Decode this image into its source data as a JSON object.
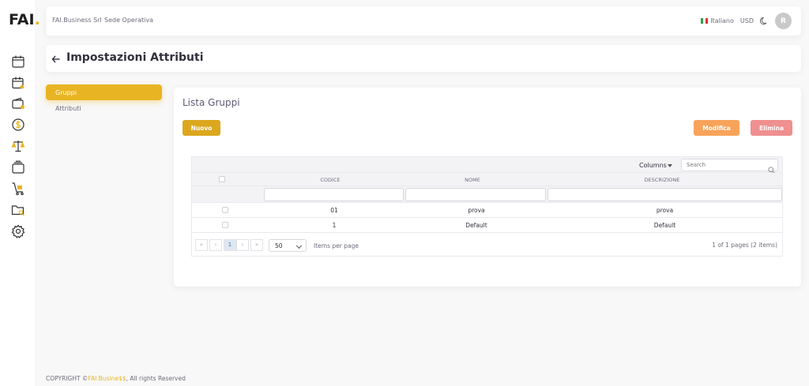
{
  "app": {
    "logo_text": "FAI",
    "logo_dot": "."
  },
  "navbar": {
    "company": "FAI.Business Srl",
    "location": "Sede Operativa",
    "language": "Italiano",
    "currency": "USD",
    "avatar_initial": "R"
  },
  "page": {
    "title": "Impostazioni Attributi"
  },
  "menu": {
    "items": [
      {
        "label": "Gruppi",
        "active": true
      },
      {
        "label": "Attributi",
        "active": false
      }
    ]
  },
  "card": {
    "title": "Lista Gruppi",
    "buttons": {
      "new": "Nuovo",
      "edit": "Modifica",
      "delete": "Elimina"
    }
  },
  "grid": {
    "columns_label": "Columns",
    "search_placeholder": "Search",
    "headers": [
      "CODICE",
      "NOME",
      "DESCRIZIONE"
    ],
    "rows": [
      {
        "codice": "01",
        "nome": "prova",
        "descrizione": "prova"
      },
      {
        "codice": "1",
        "nome": "Default",
        "descrizione": "Default"
      }
    ],
    "pager": {
      "first": "«",
      "prev": "‹",
      "current": "1",
      "next": "›",
      "last": "»",
      "page_size": "50",
      "items_per_page": "Items per page",
      "info": "1 of 1 pages (2 items)"
    }
  },
  "footer": {
    "prefix": "COPYRIGHT ©",
    "brand": "FAI.Busine$$",
    "suffix": ", All rights Reserved"
  },
  "colors": {
    "accent": "#e8b423",
    "edit": "#f8a35a",
    "delete": "#ef8f8f"
  }
}
